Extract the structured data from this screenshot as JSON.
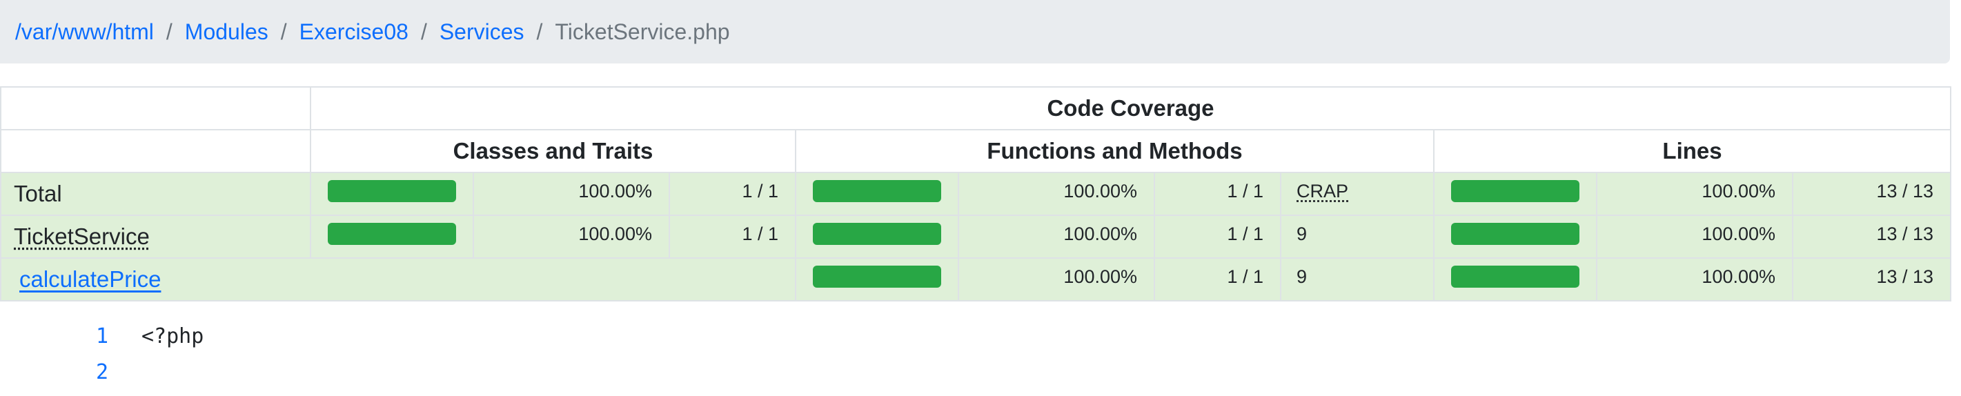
{
  "breadcrumb": {
    "items": [
      {
        "label": "/var/www/html"
      },
      {
        "label": "Modules"
      },
      {
        "label": "Exercise08"
      },
      {
        "label": "Services"
      }
    ],
    "separator": "/",
    "current": "TicketService.php"
  },
  "coverage": {
    "title": "Code Coverage",
    "groups": {
      "classes": "Classes and Traits",
      "functions": "Functions and Methods",
      "lines": "Lines"
    },
    "rows": {
      "total": {
        "name": "Total",
        "classes": {
          "percent_value": 100,
          "percent": "100.00%",
          "count": "1 / 1"
        },
        "functions": {
          "percent_value": 100,
          "percent": "100.00%",
          "count": "1 / 1",
          "crap": "CRAP"
        },
        "lines": {
          "percent_value": 100,
          "percent": "100.00%",
          "count": "13 / 13"
        }
      },
      "class": {
        "name": "TicketService",
        "classes": {
          "percent_value": 100,
          "percent": "100.00%",
          "count": "1 / 1"
        },
        "functions": {
          "percent_value": 100,
          "percent": "100.00%",
          "count": "1 / 1",
          "crap": "9"
        },
        "lines": {
          "percent_value": 100,
          "percent": "100.00%",
          "count": "13 / 13"
        }
      },
      "method": {
        "name": "calculatePrice",
        "functions": {
          "percent_value": 100,
          "percent": "100.00%",
          "count": "1 / 1",
          "crap": "9"
        },
        "lines": {
          "percent_value": 100,
          "percent": "100.00%",
          "count": "13 / 13"
        }
      }
    }
  },
  "source": {
    "lines": [
      {
        "number": "1",
        "text": "<?php"
      },
      {
        "number": "2",
        "text": ""
      }
    ]
  },
  "colors": {
    "link": "#0d6efd",
    "bar_fill": "#28a745",
    "row_success": "#dff0d8",
    "breadcrumb_bg": "#e9ecef"
  }
}
